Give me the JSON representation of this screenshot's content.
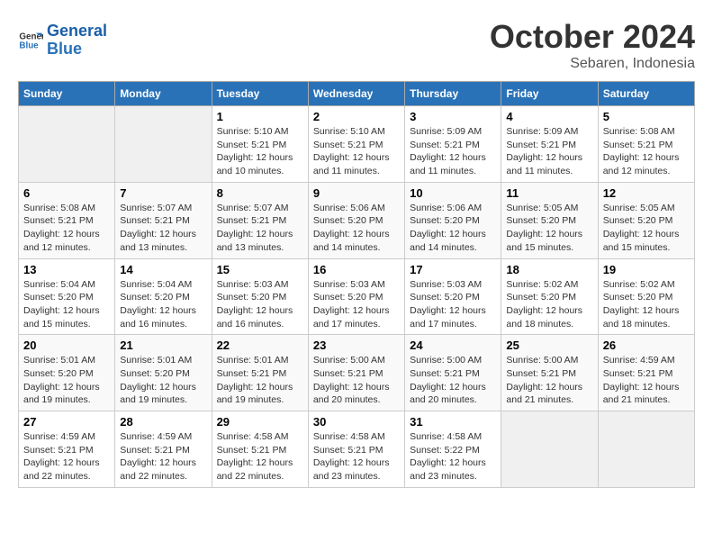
{
  "header": {
    "logo_line1": "General",
    "logo_line2": "Blue",
    "title": "October 2024",
    "subtitle": "Sebaren, Indonesia"
  },
  "days_of_week": [
    "Sunday",
    "Monday",
    "Tuesday",
    "Wednesday",
    "Thursday",
    "Friday",
    "Saturday"
  ],
  "weeks": [
    [
      {
        "day": "",
        "sunrise": "",
        "sunset": "",
        "daylight": ""
      },
      {
        "day": "",
        "sunrise": "",
        "sunset": "",
        "daylight": ""
      },
      {
        "day": "1",
        "sunrise": "Sunrise: 5:10 AM",
        "sunset": "Sunset: 5:21 PM",
        "daylight": "Daylight: 12 hours and 10 minutes."
      },
      {
        "day": "2",
        "sunrise": "Sunrise: 5:10 AM",
        "sunset": "Sunset: 5:21 PM",
        "daylight": "Daylight: 12 hours and 11 minutes."
      },
      {
        "day": "3",
        "sunrise": "Sunrise: 5:09 AM",
        "sunset": "Sunset: 5:21 PM",
        "daylight": "Daylight: 12 hours and 11 minutes."
      },
      {
        "day": "4",
        "sunrise": "Sunrise: 5:09 AM",
        "sunset": "Sunset: 5:21 PM",
        "daylight": "Daylight: 12 hours and 11 minutes."
      },
      {
        "day": "5",
        "sunrise": "Sunrise: 5:08 AM",
        "sunset": "Sunset: 5:21 PM",
        "daylight": "Daylight: 12 hours and 12 minutes."
      }
    ],
    [
      {
        "day": "6",
        "sunrise": "Sunrise: 5:08 AM",
        "sunset": "Sunset: 5:21 PM",
        "daylight": "Daylight: 12 hours and 12 minutes."
      },
      {
        "day": "7",
        "sunrise": "Sunrise: 5:07 AM",
        "sunset": "Sunset: 5:21 PM",
        "daylight": "Daylight: 12 hours and 13 minutes."
      },
      {
        "day": "8",
        "sunrise": "Sunrise: 5:07 AM",
        "sunset": "Sunset: 5:21 PM",
        "daylight": "Daylight: 12 hours and 13 minutes."
      },
      {
        "day": "9",
        "sunrise": "Sunrise: 5:06 AM",
        "sunset": "Sunset: 5:20 PM",
        "daylight": "Daylight: 12 hours and 14 minutes."
      },
      {
        "day": "10",
        "sunrise": "Sunrise: 5:06 AM",
        "sunset": "Sunset: 5:20 PM",
        "daylight": "Daylight: 12 hours and 14 minutes."
      },
      {
        "day": "11",
        "sunrise": "Sunrise: 5:05 AM",
        "sunset": "Sunset: 5:20 PM",
        "daylight": "Daylight: 12 hours and 15 minutes."
      },
      {
        "day": "12",
        "sunrise": "Sunrise: 5:05 AM",
        "sunset": "Sunset: 5:20 PM",
        "daylight": "Daylight: 12 hours and 15 minutes."
      }
    ],
    [
      {
        "day": "13",
        "sunrise": "Sunrise: 5:04 AM",
        "sunset": "Sunset: 5:20 PM",
        "daylight": "Daylight: 12 hours and 15 minutes."
      },
      {
        "day": "14",
        "sunrise": "Sunrise: 5:04 AM",
        "sunset": "Sunset: 5:20 PM",
        "daylight": "Daylight: 12 hours and 16 minutes."
      },
      {
        "day": "15",
        "sunrise": "Sunrise: 5:03 AM",
        "sunset": "Sunset: 5:20 PM",
        "daylight": "Daylight: 12 hours and 16 minutes."
      },
      {
        "day": "16",
        "sunrise": "Sunrise: 5:03 AM",
        "sunset": "Sunset: 5:20 PM",
        "daylight": "Daylight: 12 hours and 17 minutes."
      },
      {
        "day": "17",
        "sunrise": "Sunrise: 5:03 AM",
        "sunset": "Sunset: 5:20 PM",
        "daylight": "Daylight: 12 hours and 17 minutes."
      },
      {
        "day": "18",
        "sunrise": "Sunrise: 5:02 AM",
        "sunset": "Sunset: 5:20 PM",
        "daylight": "Daylight: 12 hours and 18 minutes."
      },
      {
        "day": "19",
        "sunrise": "Sunrise: 5:02 AM",
        "sunset": "Sunset: 5:20 PM",
        "daylight": "Daylight: 12 hours and 18 minutes."
      }
    ],
    [
      {
        "day": "20",
        "sunrise": "Sunrise: 5:01 AM",
        "sunset": "Sunset: 5:20 PM",
        "daylight": "Daylight: 12 hours and 19 minutes."
      },
      {
        "day": "21",
        "sunrise": "Sunrise: 5:01 AM",
        "sunset": "Sunset: 5:20 PM",
        "daylight": "Daylight: 12 hours and 19 minutes."
      },
      {
        "day": "22",
        "sunrise": "Sunrise: 5:01 AM",
        "sunset": "Sunset: 5:21 PM",
        "daylight": "Daylight: 12 hours and 19 minutes."
      },
      {
        "day": "23",
        "sunrise": "Sunrise: 5:00 AM",
        "sunset": "Sunset: 5:21 PM",
        "daylight": "Daylight: 12 hours and 20 minutes."
      },
      {
        "day": "24",
        "sunrise": "Sunrise: 5:00 AM",
        "sunset": "Sunset: 5:21 PM",
        "daylight": "Daylight: 12 hours and 20 minutes."
      },
      {
        "day": "25",
        "sunrise": "Sunrise: 5:00 AM",
        "sunset": "Sunset: 5:21 PM",
        "daylight": "Daylight: 12 hours and 21 minutes."
      },
      {
        "day": "26",
        "sunrise": "Sunrise: 4:59 AM",
        "sunset": "Sunset: 5:21 PM",
        "daylight": "Daylight: 12 hours and 21 minutes."
      }
    ],
    [
      {
        "day": "27",
        "sunrise": "Sunrise: 4:59 AM",
        "sunset": "Sunset: 5:21 PM",
        "daylight": "Daylight: 12 hours and 22 minutes."
      },
      {
        "day": "28",
        "sunrise": "Sunrise: 4:59 AM",
        "sunset": "Sunset: 5:21 PM",
        "daylight": "Daylight: 12 hours and 22 minutes."
      },
      {
        "day": "29",
        "sunrise": "Sunrise: 4:58 AM",
        "sunset": "Sunset: 5:21 PM",
        "daylight": "Daylight: 12 hours and 22 minutes."
      },
      {
        "day": "30",
        "sunrise": "Sunrise: 4:58 AM",
        "sunset": "Sunset: 5:21 PM",
        "daylight": "Daylight: 12 hours and 23 minutes."
      },
      {
        "day": "31",
        "sunrise": "Sunrise: 4:58 AM",
        "sunset": "Sunset: 5:22 PM",
        "daylight": "Daylight: 12 hours and 23 minutes."
      },
      {
        "day": "",
        "sunrise": "",
        "sunset": "",
        "daylight": ""
      },
      {
        "day": "",
        "sunrise": "",
        "sunset": "",
        "daylight": ""
      }
    ]
  ]
}
